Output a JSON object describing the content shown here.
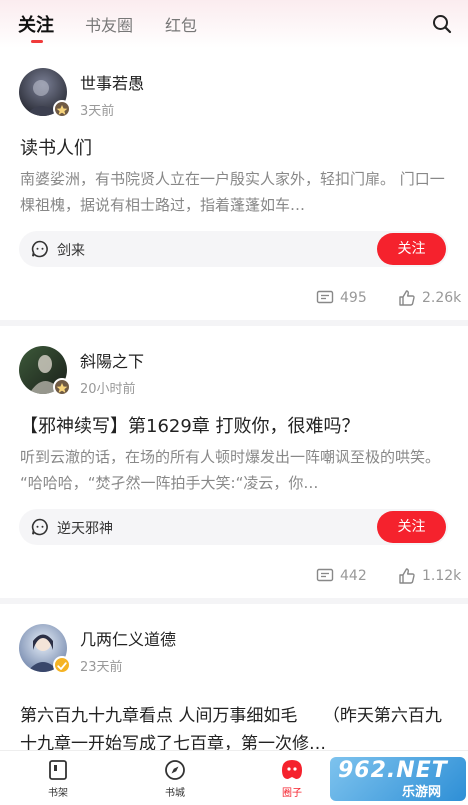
{
  "header": {
    "tabs": [
      {
        "label": "关注",
        "active": true
      },
      {
        "label": "书友圈",
        "active": false
      },
      {
        "label": "红包",
        "active": false
      }
    ],
    "search_icon": "search-icon"
  },
  "posts": [
    {
      "username": "世事若愚",
      "time": "3天前",
      "title": "读书人们",
      "excerpt": "南婆娑洲，有书院贤人立在一户殷实人家外，轻扣门扉。 门口一棵祖槐，据说有相士路过，指着蓬蓬如车…",
      "circle": "剑来",
      "follow_label": "关注",
      "comments": "495",
      "likes": "2.26k"
    },
    {
      "username": "斜陽之下",
      "time": "20小时前",
      "title": "【邪神续写】第1629章 打败你，很难吗？",
      "excerpt": "听到云澈的话，在场的所有人顿时爆发出一阵嘲讽至极的哄笑。 “哈哈哈，“焚孑然一阵拍手大笑:“凌云，你…",
      "circle": "逆天邪神",
      "follow_label": "关注",
      "comments": "442",
      "likes": "1.12k"
    },
    {
      "username": "几两仁义道德",
      "time": "23天前",
      "excerpt": "第六百九十九章看点 人间万事细如毛　　（昨天第六百九十九章一开始写成了七百章，第一次修…"
    }
  ],
  "bottom_nav": [
    {
      "label": "书架",
      "icon": "bookshelf-icon",
      "active": false
    },
    {
      "label": "书城",
      "icon": "compass-icon",
      "active": false
    },
    {
      "label": "圈子",
      "icon": "circle-mascot-icon",
      "active": true
    }
  ],
  "watermark": {
    "main": "962.NET",
    "sub": "乐游网"
  },
  "colors": {
    "accent": "#f5222d",
    "tab_indicator": "#f03a3a",
    "excerpt": "#888888",
    "meta": "#999999"
  }
}
